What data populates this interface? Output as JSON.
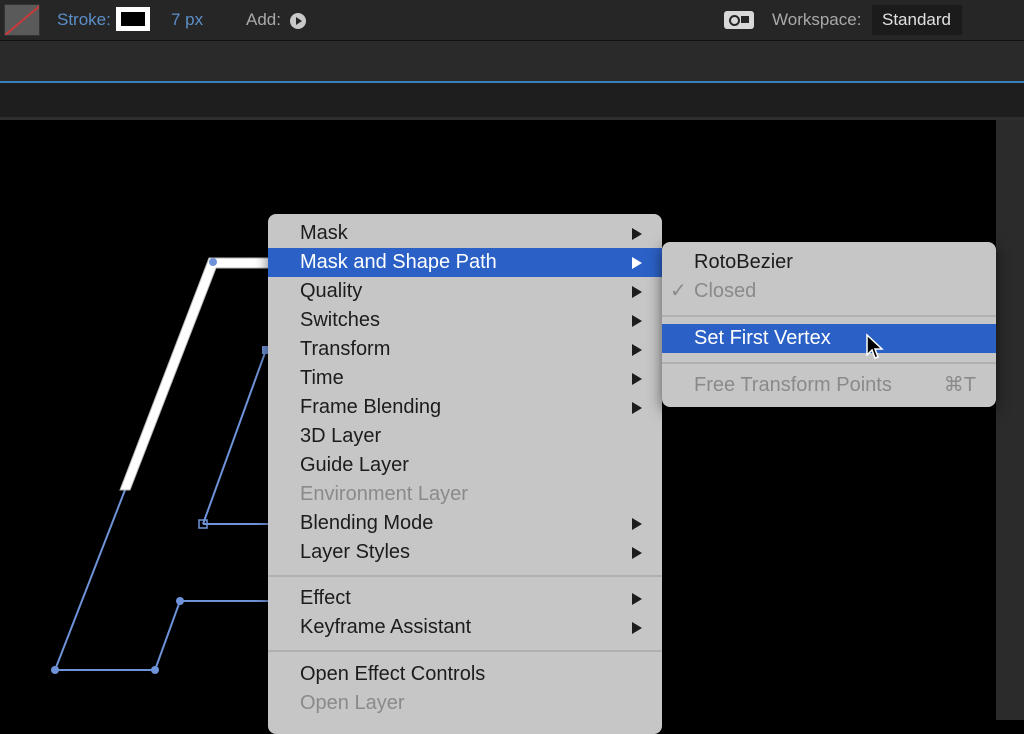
{
  "toolbar": {
    "stroke_label": "Stroke:",
    "stroke_width": "7 px",
    "add_label": "Add:",
    "workspace_label": "Workspace:",
    "workspace_value": "Standard"
  },
  "context_menu": {
    "items": [
      {
        "label": "Mask"
      },
      {
        "label": "Mask and Shape Path"
      },
      {
        "label": "Quality"
      },
      {
        "label": "Switches"
      },
      {
        "label": "Transform"
      },
      {
        "label": "Time"
      },
      {
        "label": "Frame Blending"
      },
      {
        "label": "3D Layer"
      },
      {
        "label": "Guide Layer"
      },
      {
        "label": "Environment Layer"
      },
      {
        "label": "Blending Mode"
      },
      {
        "label": "Layer Styles"
      },
      {
        "label": "Effect"
      },
      {
        "label": "Keyframe Assistant"
      },
      {
        "label": "Open Effect Controls"
      },
      {
        "label": "Open Layer"
      }
    ]
  },
  "submenu": {
    "items": [
      {
        "label": "RotoBezier"
      },
      {
        "label": "Closed",
        "check": "✓"
      },
      {
        "label": "Set First Vertex"
      },
      {
        "label": "Free Transform Points",
        "shortcut": "⌘T"
      }
    ]
  },
  "colors": {
    "highlight": "#2b61c6",
    "menu_bg": "#c6c6c6",
    "path_blue": "#6f93d8"
  }
}
